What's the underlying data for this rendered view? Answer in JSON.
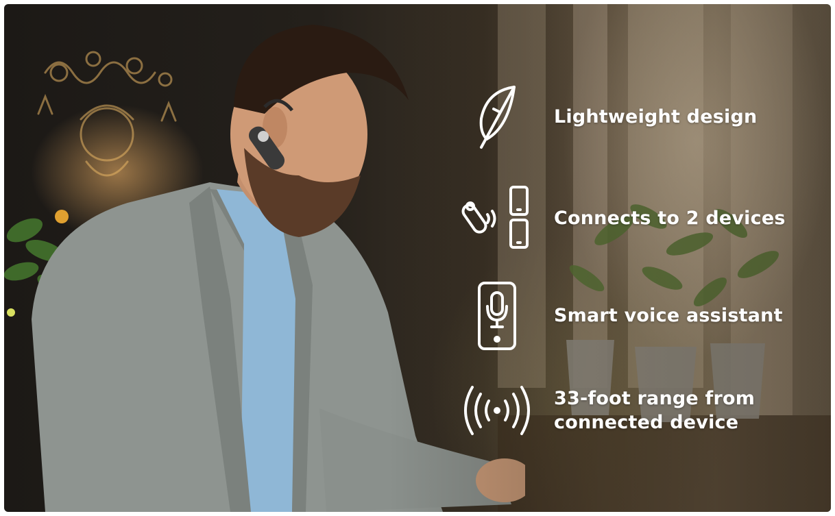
{
  "features": [
    {
      "icon": "feather-icon",
      "label": "Lightweight design"
    },
    {
      "icon": "headset-phones-icon",
      "label": "Connects to 2 devices"
    },
    {
      "icon": "phone-microphone-icon",
      "label": "Smart voice assistant"
    },
    {
      "icon": "wireless-signal-icon",
      "label": "33-foot range from\nconnected device"
    }
  ],
  "colors": {
    "text": "#ffffff",
    "icon_stroke": "#ffffff"
  }
}
